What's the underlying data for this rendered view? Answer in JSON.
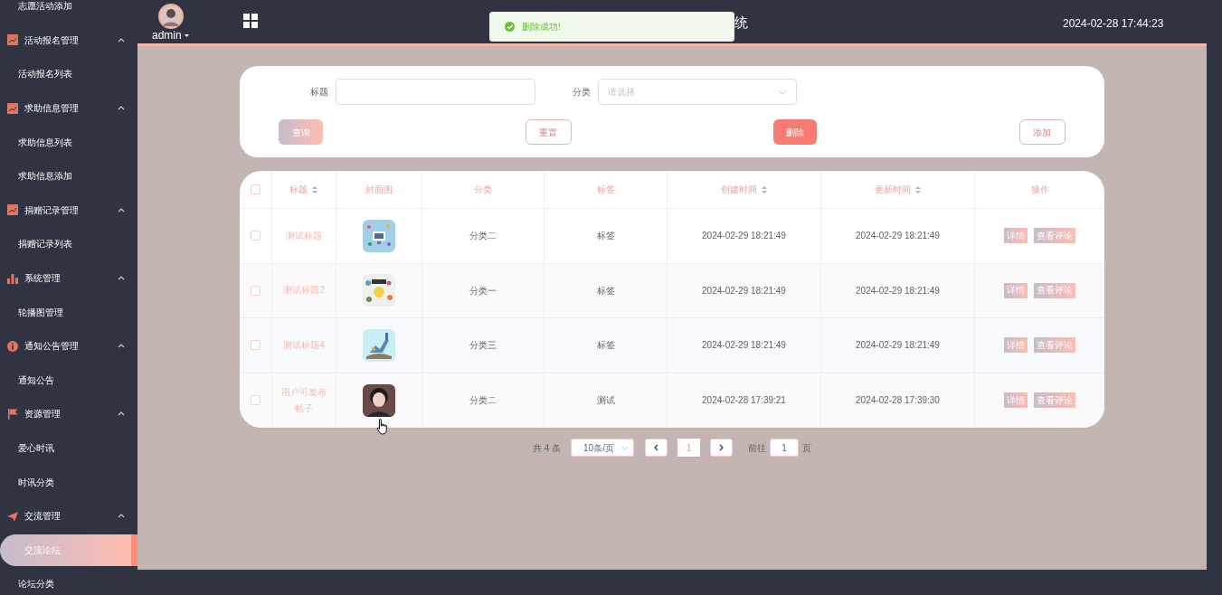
{
  "header": {
    "user": "admin",
    "title": "统",
    "datetime": "2024-02-28 17:44:23"
  },
  "toast": {
    "kind": "success",
    "message": "删除成功!"
  },
  "sidebar": {
    "sections": [
      {
        "children": [
          {
            "label": "志愿活动添加",
            "selected": false
          }
        ]
      },
      {
        "label": "活动报名管理",
        "expanded": true,
        "children": [
          {
            "label": "活动报名列表",
            "selected": false
          }
        ]
      },
      {
        "label": "求助信息管理",
        "expanded": true,
        "children": [
          {
            "label": "求助信息列表",
            "selected": false
          },
          {
            "label": "求助信息添加",
            "selected": false
          }
        ]
      },
      {
        "label": "捐赠记录管理",
        "expanded": true,
        "children": [
          {
            "label": "捐赠记录列表",
            "selected": false
          }
        ]
      },
      {
        "label": "系统管理",
        "expanded": true,
        "children": [
          {
            "label": "轮播图管理",
            "selected": false
          }
        ]
      },
      {
        "label": "通知公告管理",
        "expanded": true,
        "children": [
          {
            "label": "通知公告",
            "selected": false
          }
        ]
      },
      {
        "label": "资源管理",
        "expanded": true,
        "children": [
          {
            "label": "爱心时讯",
            "selected": false
          },
          {
            "label": "时讯分类",
            "selected": false
          }
        ]
      },
      {
        "label": "交流管理",
        "expanded": true,
        "children": [
          {
            "label": "交流论坛",
            "selected": true
          },
          {
            "label": "论坛分类",
            "selected": false
          }
        ]
      }
    ]
  },
  "search": {
    "fields": [
      {
        "label": "标题",
        "kind": "text"
      },
      {
        "label": "分类",
        "kind": "select",
        "placeholder": "请选择"
      }
    ],
    "actions": [
      {
        "label": "查询",
        "kind": "gradient"
      },
      {
        "label": "重置",
        "kind": "outline"
      },
      {
        "label": "删除",
        "kind": "danger"
      },
      {
        "label": "添加",
        "kind": "outline"
      }
    ]
  },
  "table": {
    "columns": [
      {
        "kind": "checkbox",
        "checked": false
      },
      {
        "kind": "text",
        "label": "标题",
        "sortable": true
      },
      {
        "kind": "text",
        "label": "封面图",
        "sortable": false
      },
      {
        "kind": "text",
        "label": "分类",
        "sortable": false
      },
      {
        "kind": "text",
        "label": "标签",
        "sortable": false
      },
      {
        "kind": "text",
        "label": "创建时间",
        "sortable": true
      },
      {
        "kind": "text",
        "label": "更新时间",
        "sortable": true
      },
      {
        "kind": "text",
        "label": "操作",
        "sortable": false
      }
    ],
    "rows": [
      {
        "checked": false,
        "title": "测试标题",
        "category": "分类二",
        "tag": "标签",
        "created": "2024-02-29 18:21:49",
        "updated": "2024-02-29 18:21:49",
        "actions": [
          "详情",
          "查看评论"
        ]
      },
      {
        "checked": false,
        "title": "测试标题2",
        "category": "分类一",
        "tag": "标签",
        "created": "2024-02-29 18:21:49",
        "updated": "2024-02-29 18:21:49",
        "actions": [
          "详情",
          "查看评论"
        ]
      },
      {
        "checked": false,
        "title": "测试标题4",
        "category": "分类三",
        "tag": "标签",
        "created": "2024-02-29 18:21:49",
        "updated": "2024-02-29 18:21:49",
        "actions": [
          "详情",
          "查看评论"
        ]
      },
      {
        "checked": false,
        "title": "用户可发布帖子",
        "category": "分类二",
        "tag": "测试",
        "created": "2024-02-28 17:39:21",
        "updated": "2024-02-28 17:39:30",
        "actions": [
          "详情",
          "查看评论"
        ]
      }
    ]
  },
  "pagination": {
    "total": "共 4 条",
    "page_size": "10条/页",
    "pages": [
      {
        "label": "1",
        "selected": true
      }
    ],
    "jump_label": "前往",
    "jump_value": "1",
    "page_suffix": "页"
  }
}
